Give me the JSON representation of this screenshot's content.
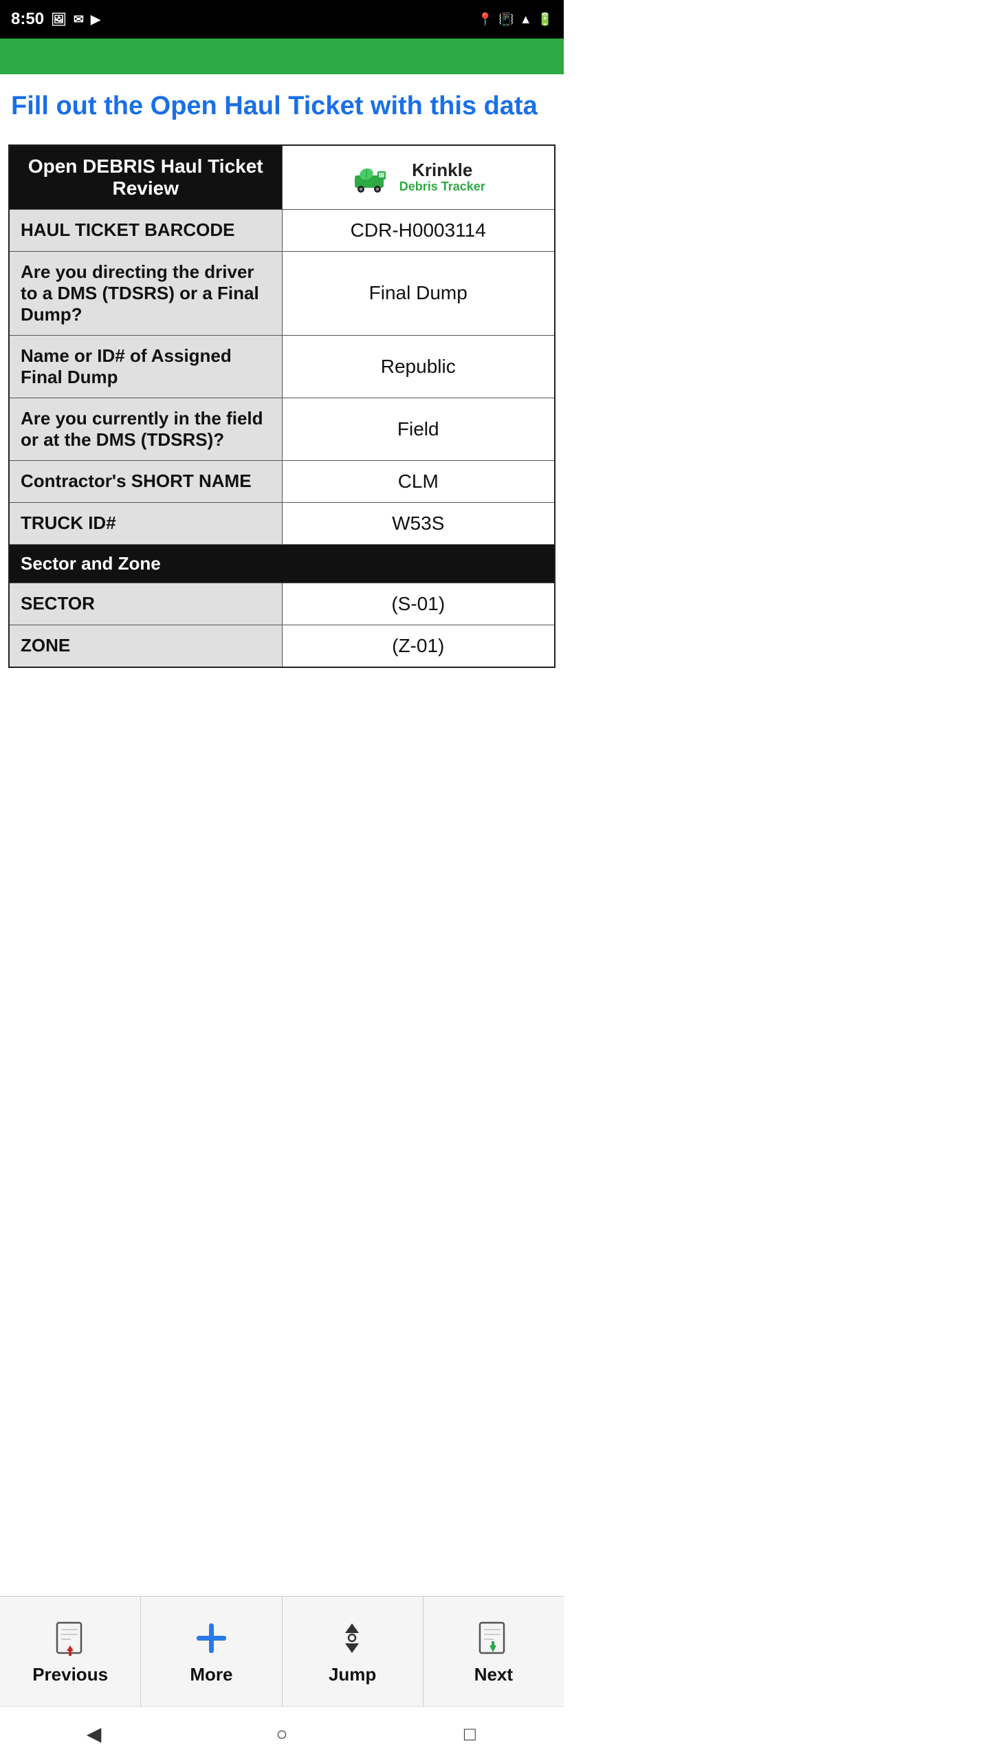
{
  "statusBar": {
    "time": "8:50",
    "icons": [
      "photo",
      "email",
      "play"
    ]
  },
  "header": {
    "title": "Fill out the Open Haul Ticket with this data"
  },
  "table": {
    "headerLeft": "Open DEBRIS Haul Ticket Review",
    "logo": {
      "name": "Krinkle",
      "subtitle": "Debris Tracker"
    },
    "rows": [
      {
        "label": "HAUL TICKET BARCODE",
        "value": "CDR-H0003114"
      },
      {
        "label": "Are you directing the driver to a DMS (TDSRS) or a Final Dump?",
        "value": "Final Dump"
      },
      {
        "label": "Name or ID# of Assigned Final Dump",
        "value": "Republic"
      },
      {
        "label": "Are you currently in the field or at the DMS (TDSRS)?",
        "value": "Field"
      },
      {
        "label": "Contractor's SHORT NAME",
        "value": "CLM"
      },
      {
        "label": "TRUCK ID#",
        "value": "W53S"
      }
    ],
    "sectionHeader": "Sector and Zone",
    "sectionRows": [
      {
        "label": "SECTOR",
        "value": "(S-01)"
      },
      {
        "label": "ZONE",
        "value": "(Z-01)"
      }
    ]
  },
  "bottomNav": {
    "buttons": [
      {
        "id": "previous",
        "label": "Previous",
        "iconType": "doc-up-red"
      },
      {
        "id": "more",
        "label": "More",
        "iconType": "plus-blue"
      },
      {
        "id": "jump",
        "label": "Jump",
        "iconType": "jump-arrows"
      },
      {
        "id": "next",
        "label": "Next",
        "iconType": "doc-down-green"
      }
    ]
  },
  "systemNav": {
    "back": "◀",
    "home": "○",
    "recents": "□"
  }
}
